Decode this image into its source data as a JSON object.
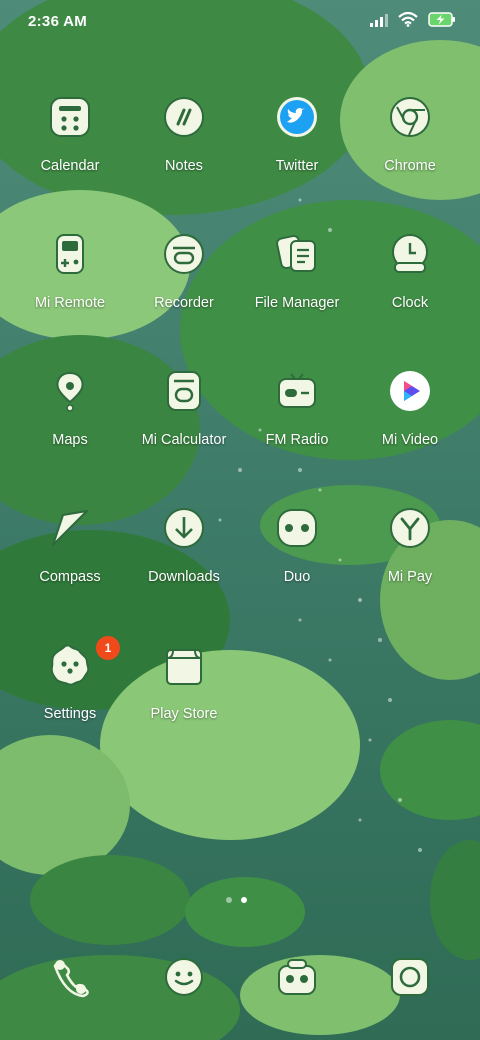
{
  "status_bar": {
    "time": "2:36 AM",
    "icons": [
      "signal-icon",
      "wifi-icon",
      "battery-charging-icon"
    ]
  },
  "apps": [
    {
      "label": "Calendar",
      "icon": "calendar-icon"
    },
    {
      "label": "Notes",
      "icon": "notes-icon"
    },
    {
      "label": "Twitter",
      "icon": "twitter-icon"
    },
    {
      "label": "Chrome",
      "icon": "chrome-icon"
    },
    {
      "label": "Mi Remote",
      "icon": "remote-icon"
    },
    {
      "label": "Recorder",
      "icon": "recorder-icon"
    },
    {
      "label": "File Manager",
      "icon": "file-manager-icon"
    },
    {
      "label": "Clock",
      "icon": "clock-icon"
    },
    {
      "label": "Maps",
      "icon": "maps-icon"
    },
    {
      "label": "Mi Calculator",
      "icon": "calculator-icon"
    },
    {
      "label": "FM Radio",
      "icon": "radio-icon"
    },
    {
      "label": "Mi Video",
      "icon": "video-icon"
    },
    {
      "label": "Compass",
      "icon": "compass-icon"
    },
    {
      "label": "Downloads",
      "icon": "downloads-icon"
    },
    {
      "label": "Duo",
      "icon": "duo-icon"
    },
    {
      "label": "Mi Pay",
      "icon": "mi-pay-icon"
    },
    {
      "label": "Settings",
      "icon": "settings-icon",
      "badge": "1"
    },
    {
      "label": "Play Store",
      "icon": "play-store-icon"
    }
  ],
  "page_indicator": {
    "pages": 2,
    "current": 2
  },
  "dock": [
    {
      "icon": "phone-icon"
    },
    {
      "icon": "messages-icon"
    },
    {
      "icon": "gallery-icon"
    },
    {
      "icon": "camera-icon"
    }
  ],
  "colors": {
    "icon_fill": "#f2f6e4",
    "icon_stroke": "#2e6b3c",
    "leaf_light": "#8cc87a",
    "leaf_dark": "#3f8a45",
    "water": "#3c7a6a",
    "badge": "#f04a1a"
  }
}
